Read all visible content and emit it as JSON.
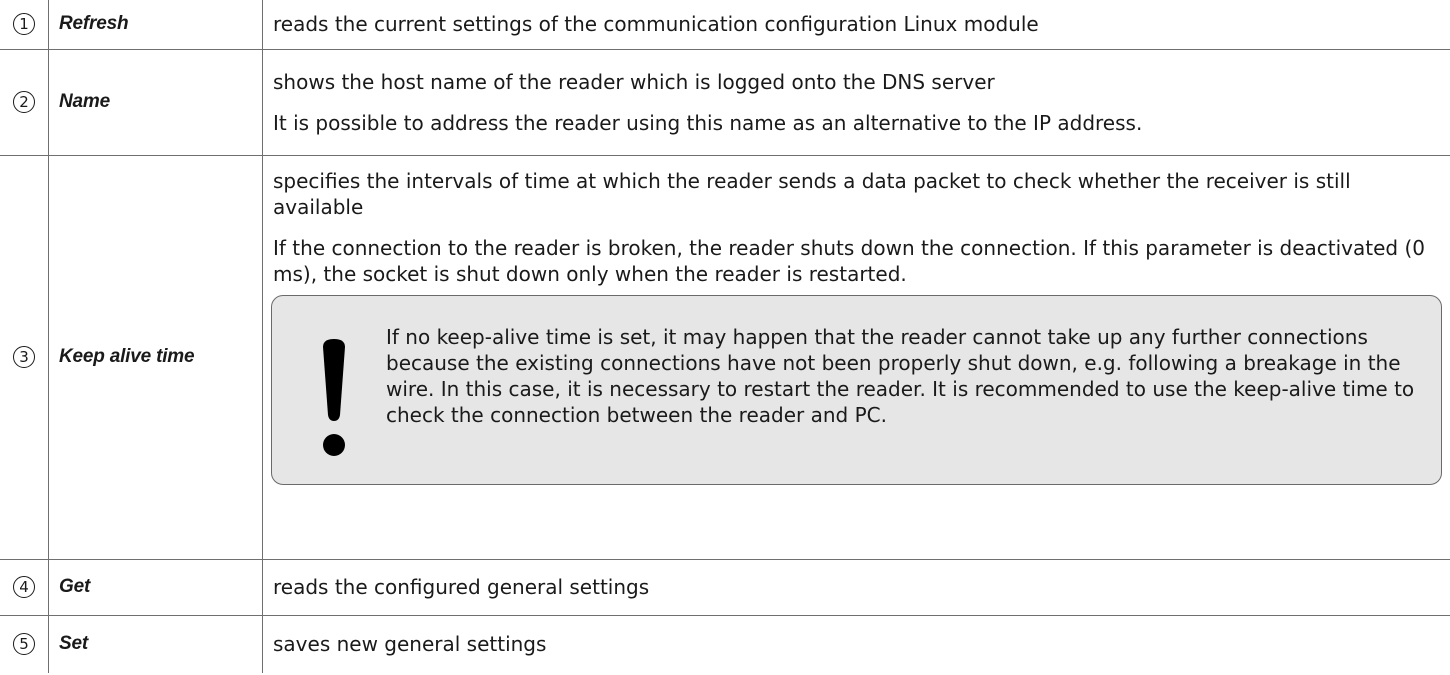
{
  "rows": [
    {
      "num": "1",
      "term": "Refresh",
      "paragraphs": [
        "reads the current settings of the communication configuration Linux module"
      ]
    },
    {
      "num": "2",
      "term": "Name",
      "paragraphs": [
        "shows the host name of the reader which is logged onto the DNS server",
        "It is possible to address the reader using this name as an alternative to the IP address."
      ]
    },
    {
      "num": "3",
      "term": "Keep alive time",
      "paragraphs": [
        "specifies the intervals of time at which the reader sends a data packet to check whether the receiver is still available",
        "If the connection to the reader is broken, the reader shuts down the connection. If this parameter is deactivated (0 ms), the socket is shut down only when the reader is restarted."
      ],
      "note": {
        "icon": "exclamation-icon",
        "text": "If no keep-alive time is set, it may happen that the reader cannot take up any further connections because the existing connections have not been properly shut down, e.g. following a breakage in the wire. In this case, it is necessary to restart the reader. It is recommended to use the keep-alive time to check the connection between the reader and PC."
      }
    },
    {
      "num": "4",
      "term": "Get",
      "paragraphs": [
        "reads the configured general settings"
      ]
    },
    {
      "num": "5",
      "term": "Set",
      "paragraphs": [
        "saves  new general settings"
      ]
    }
  ]
}
